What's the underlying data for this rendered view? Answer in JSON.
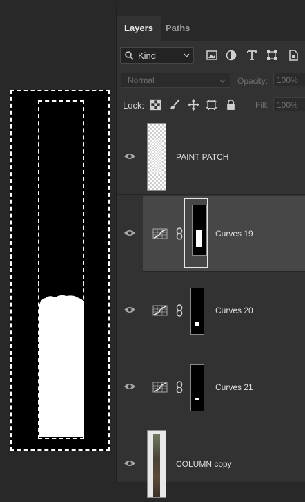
{
  "panel": {
    "tabs": [
      {
        "label": "Layers",
        "active": true
      },
      {
        "label": "Paths",
        "active": false
      }
    ],
    "filter": {
      "kind_label": "Kind",
      "icons": [
        "pixel-filter-icon",
        "adjustment-filter-icon",
        "type-filter-icon",
        "shape-filter-icon",
        "smart-object-filter-icon"
      ]
    },
    "blend_mode": "Normal",
    "opacity_label": "Opacity:",
    "opacity_value": "100%",
    "lock_label": "Lock:",
    "fill_label": "Fill:",
    "fill_value": "100%",
    "layers": [
      {
        "name": "PAINT PATCH",
        "type": "pixel",
        "selected": false
      },
      {
        "name": "Curves 19",
        "type": "curves-adjustment",
        "selected": true
      },
      {
        "name": "Curves 20",
        "type": "curves-adjustment",
        "selected": false
      },
      {
        "name": "Curves 21",
        "type": "curves-adjustment",
        "selected": false
      },
      {
        "name": "COLUMN copy",
        "type": "pixel",
        "selected": false
      }
    ]
  },
  "colors": {
    "panel_bg": "#323232",
    "selected_row": "#474747",
    "canvas_bg": "#282828"
  }
}
